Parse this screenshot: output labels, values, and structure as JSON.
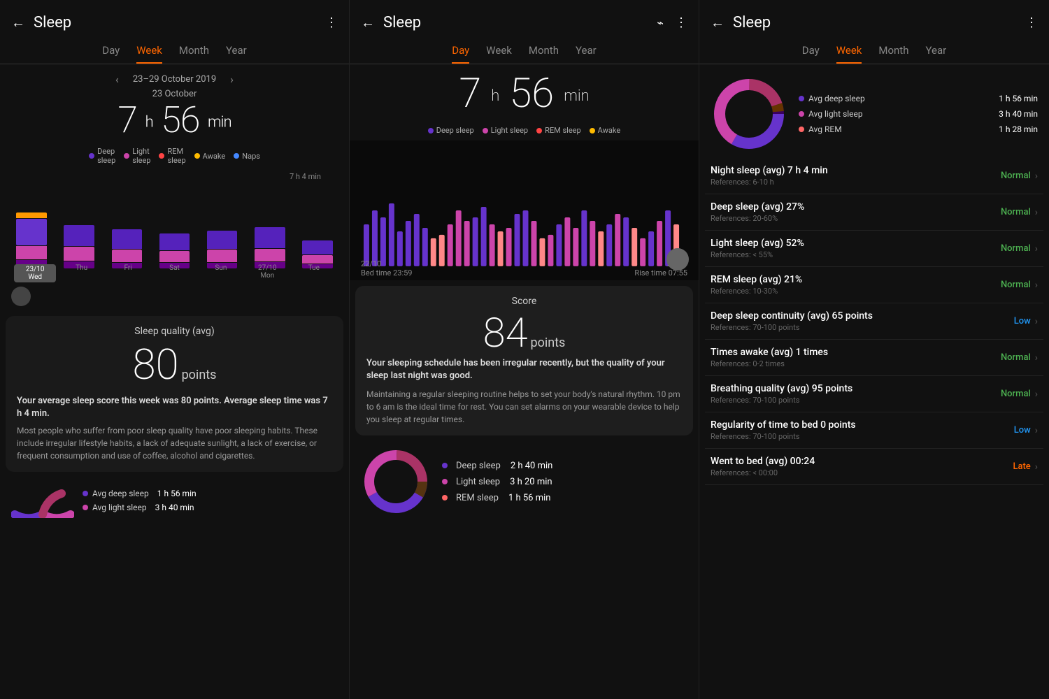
{
  "panels": [
    {
      "id": "panel1",
      "header": {
        "back_label": "←",
        "title": "Sleep",
        "menu_icon": "⋮"
      },
      "tabs": [
        "Day",
        "Week",
        "Month",
        "Year"
      ],
      "active_tab": "Week",
      "date_range": "23–29 October 2019",
      "sub_date": "23 October",
      "sleep_hours": "7",
      "sleep_h_unit": "h",
      "sleep_minutes": "56",
      "sleep_min_unit": "min",
      "legend": [
        {
          "label": "Deep sleep",
          "color": "#6633CC"
        },
        {
          "label": "Light sleep",
          "color": "#CC44AA"
        },
        {
          "label": "REM sleep",
          "color": "#FF4444"
        },
        {
          "label": "Awake",
          "color": "#FFBB00"
        },
        {
          "label": "Naps",
          "color": "#4488FF"
        }
      ],
      "bar_label": "7 h 4 min",
      "bars": [
        {
          "deep": 80,
          "light": 40,
          "rem": 10,
          "highlight": true,
          "label": "23/10\nWed"
        },
        {
          "deep": 55,
          "light": 35,
          "rem": 8,
          "highlight": false,
          "label": "Thu"
        },
        {
          "deep": 50,
          "light": 30,
          "rem": 7,
          "highlight": false,
          "label": "Fri"
        },
        {
          "deep": 45,
          "light": 28,
          "rem": 6,
          "highlight": false,
          "label": "Sat"
        },
        {
          "deep": 48,
          "light": 32,
          "rem": 7,
          "highlight": false,
          "label": "Sun"
        },
        {
          "deep": 52,
          "light": 33,
          "rem": 8,
          "highlight": false,
          "label": "27/10\nMon"
        },
        {
          "deep": 38,
          "light": 25,
          "rem": 5,
          "highlight": false,
          "label": "Tue"
        }
      ],
      "score_card": {
        "label": "Sleep quality (avg)",
        "value": "80",
        "unit": "points",
        "title_text": "Your average sleep score this week was 80 points. Average sleep time was 7 h 4 min.",
        "body_text": "Most people who suffer from poor sleep quality have poor sleeping habits. These include irregular lifestyle habits, a lack of adequate sunlight, a lack of exercise, or frequent consumption and use of coffee, alcohol and cigarettes."
      },
      "donut": {
        "legend": [
          {
            "label": "Avg deep sleep",
            "color": "#6633CC",
            "value": "1 h 56 min"
          },
          {
            "label": "Avg light sleep",
            "color": "#CC44AA",
            "value": "3 h 40 min"
          }
        ]
      }
    },
    {
      "id": "panel2",
      "header": {
        "back_label": "←",
        "title": "Sleep",
        "sync_icon": "⌁",
        "menu_icon": "⋮"
      },
      "tabs": [
        "Day",
        "Week",
        "Month",
        "Year"
      ],
      "active_tab": "Day",
      "sleep_hours": "7",
      "sleep_h_unit": "h",
      "sleep_minutes": "56",
      "sleep_min_unit": "min",
      "legend": [
        {
          "label": "Deep sleep",
          "color": "#6633CC"
        },
        {
          "label": "Light sleep",
          "color": "#CC44AA"
        },
        {
          "label": "REM sleep",
          "color": "#FF4444"
        },
        {
          "label": "Awake",
          "color": "#FFBB00"
        }
      ],
      "bed_time": "22/10\nBed time 23:59",
      "rise_time": "23/10\nRise time 07:55",
      "score": {
        "label": "Score",
        "value": "84",
        "unit": "points",
        "title_text": "Your sleeping schedule has been irregular recently, but the quality of your sleep last night was good.",
        "body_text": "Maintaining a regular sleeping routine helps to set your body's natural rhythm. 10 pm to 6 am is the ideal time for rest. You can set alarms on your wearable device to help you sleep at regular times."
      },
      "donut_legend": [
        {
          "label": "Deep sleep",
          "color": "#6633CC",
          "value": "2 h 40 min"
        },
        {
          "label": "Light sleep",
          "color": "#CC44AA",
          "value": "3 h 20 min"
        },
        {
          "label": "REM sleep",
          "color": "#FF6666",
          "value": "1 h 56 min"
        }
      ]
    },
    {
      "id": "panel3",
      "header": {
        "back_label": "←",
        "title": "Sleep",
        "menu_icon": "⋮"
      },
      "tabs": [
        "Day",
        "Week",
        "Month",
        "Year"
      ],
      "active_tab": "Week",
      "donut_legend": [
        {
          "label": "Avg deep sleep",
          "color": "#6633CC",
          "value": "1 h 56 min"
        },
        {
          "label": "Avg light sleep",
          "color": "#CC44AA",
          "value": "3 h 40 min"
        },
        {
          "label": "Avg REM",
          "color": "#FF6666",
          "value": "1 h 28 min"
        }
      ],
      "metrics": [
        {
          "title": "Night sleep (avg)  7 h 4 min",
          "ref": "References: 6-10 h",
          "status": "Normal",
          "status_type": "normal"
        },
        {
          "title": "Deep sleep (avg)  27%",
          "ref": "References: 20-60%",
          "status": "Normal",
          "status_type": "normal"
        },
        {
          "title": "Light sleep (avg)  52%",
          "ref": "References: < 55%",
          "status": "Normal",
          "status_type": "normal"
        },
        {
          "title": "REM sleep (avg)  21%",
          "ref": "References: 10-30%",
          "status": "Normal",
          "status_type": "normal"
        },
        {
          "title": "Deep sleep continuity (avg)  65 points",
          "ref": "References: 70-100 points",
          "status": "Low",
          "status_type": "low"
        },
        {
          "title": "Times awake (avg)  1 times",
          "ref": "References: 0-2 times",
          "status": "Normal",
          "status_type": "normal"
        },
        {
          "title": "Breathing quality (avg)  95 points",
          "ref": "References: 70-100 points",
          "status": "Normal",
          "status_type": "normal"
        },
        {
          "title": "Regularity of time to bed  0 points",
          "ref": "References: 70-100 points",
          "status": "Low",
          "status_type": "low"
        },
        {
          "title": "Went to bed (avg)  00:24",
          "ref": "References: < 00:00",
          "status": "Late",
          "status_type": "late"
        }
      ]
    }
  ]
}
